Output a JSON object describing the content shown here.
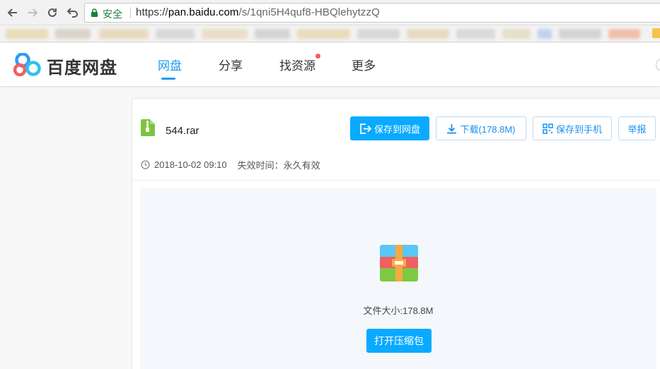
{
  "browser": {
    "secure_label": "安全",
    "url_scheme": "https://",
    "url_host": "pan.baidu.com",
    "url_path": "/s/1qni5H4quf8-HBQlehytzzQ"
  },
  "header": {
    "logo_text": "百度网盘",
    "nav": [
      {
        "label": "网盘",
        "active": true
      },
      {
        "label": "分享",
        "active": false
      },
      {
        "label": "找资源",
        "active": false
      },
      {
        "label": "更多",
        "active": false
      }
    ]
  },
  "file": {
    "name": "544.rar",
    "created": "2018-10-02 09:10",
    "expire": "失效时间：永久有效",
    "size_label": "文件大小:178.8M"
  },
  "actions": {
    "save_to_pan": "保存到网盘",
    "download": "下载(178.8M)",
    "save_to_phone": "保存到手机",
    "report": "举报",
    "open_archive": "打开压缩包"
  },
  "colors": {
    "accent": "#09aaff",
    "nav_active": "#1a9cf0",
    "notice_dot": "#f25d55"
  }
}
